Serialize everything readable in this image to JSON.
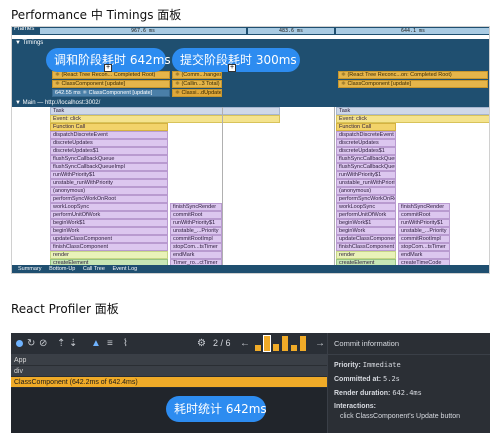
{
  "captions": {
    "performance": "Performance 中 Timings 面板",
    "profiler": "React Profiler 面板"
  },
  "perf": {
    "frames_label": "Frames",
    "frame_times": [
      "967.6 ms",
      "483.6 ms",
      "644.1 ms"
    ],
    "timings_label": "▼ Timings",
    "main_label": "▼ Main — http://localhost:3002/",
    "timing_bars": [
      "⚛ (React Tree Recon... Completed Root)",
      "⚛ ClassComponent [update]",
      "642.55 ms ⚛ ClassComponent [update]",
      "⚛ (Comm...hanges)",
      "⚛ (Callin...3 Total)",
      "⚛ Classi...dUpdate",
      "⚛ (React Tree Reconc...on: Completed Root)",
      "⚛ ClassComponent [update]"
    ],
    "annotations": {
      "reconcile": "调和阶段耗时 642ms",
      "commit": "提交阶段耗时 300ms"
    },
    "flame_left": [
      "Task",
      "Event: click",
      "Function Call",
      "dispatchDiscreteEvent",
      "discreteUpdates",
      "discreteUpdates$1",
      "flushSyncCallbackQueue",
      "flushSyncCallbackQueueImpl",
      "runWithPriority$1",
      "unstable_runWithPriority",
      "(anonymous)",
      "performSyncWorkOnRoot",
      "workLoopSync",
      "performUnitOfWork",
      "beginWork$1",
      "beginWork",
      "updateClassComponent",
      "finishClassComponent",
      "render",
      "createElement"
    ],
    "flame_left_sub": [
      "finishSyncRender",
      "commitRoot",
      "runWithPriority$1",
      "unstable_...Priority",
      "commitRootImpl",
      "stopCom...tsTimer",
      "endMark",
      "Timer_ro...ctTimer"
    ],
    "flame_right": [
      "Task",
      "Event: click",
      "Function Call",
      "dispatchDiscreteEvent",
      "discreteUpdates",
      "discreteUpdates$1",
      "flushSyncCallbackQueue",
      "flushSyncCallbackQueueImpl",
      "runWithPriority$1",
      "unstable_runWithPriority",
      "(anonymous)",
      "performSyncWorkOnRoot",
      "workLoopSync",
      "performUnitOfWork",
      "beginWork$1",
      "beginWork",
      "updateClassComponent",
      "finishClassComponent",
      "render",
      "createElement"
    ],
    "flame_right_sub": [
      "finishSyncRender",
      "commitRoot",
      "runWithPriority$1",
      "unstable_...Priority",
      "commitRootImpl",
      "stopCom...tsTimer",
      "endMark",
      "createTimeCode"
    ],
    "bottom_tabs": [
      "Summary",
      "Bottom-Up",
      "Call Tree",
      "Event Log"
    ]
  },
  "profiler": {
    "commit_index": "2 / 6",
    "tree": [
      "App",
      "div",
      "ClassComponent (642.2ms of 642.4ms)"
    ],
    "annotation": "耗时统计 642ms",
    "commit_bar_levels": [
      0.35,
      0.95,
      0.45,
      0.95,
      0.4,
      0.95
    ],
    "info": {
      "header": "Commit information",
      "priority_label": "Priority:",
      "priority_value": "Immediate",
      "committed_label": "Committed at:",
      "committed_value": "5.2s",
      "render_label": "Render duration:",
      "render_value": "642.4ms",
      "interactions_label": "Interactions:",
      "interactions_value": "click ClassComponent's Update button"
    }
  }
}
